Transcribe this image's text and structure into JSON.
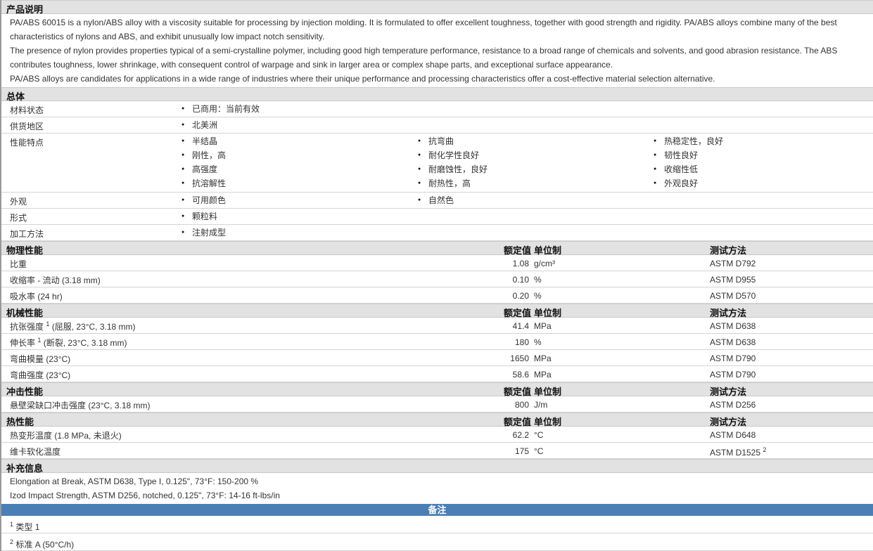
{
  "description": {
    "title": "产品说明",
    "paragraphs": [
      "PA/ABS 60015 is a nylon/ABS alloy with a viscosity suitable for processing by injection molding. It is formulated to offer excellent toughness, together with good strength and rigidity. PA/ABS alloys combine many of the best characteristics of nylons and ABS, and exhibit unusually low impact notch sensitivity.",
      "The presence of nylon provides properties typical of a semi-crystalline polymer, including good high temperature performance, resistance to a broad range of chemicals and solvents, and good abrasion resistance. The ABS contributes toughness, lower shrinkage, with consequent control of warpage and sink in larger area or complex shape parts, and exceptional surface appearance.",
      "PA/ABS alloys are candidates for applications in a wide range of industries where their unique performance and processing characteristics offer a cost-effective material selection alternative."
    ]
  },
  "general": {
    "title": "总体",
    "rows": [
      {
        "label": "材料状态",
        "items": [
          "已商用：当前有效"
        ]
      },
      {
        "label": "供货地区",
        "items": [
          "北美洲"
        ]
      },
      {
        "label": "性能特点",
        "items": [
          "半结晶",
          "刚性，高",
          "高强度",
          "抗溶解性",
          "抗弯曲",
          "耐化学性良好",
          "耐磨蚀性，良好",
          "耐热性，高",
          "热稳定性，良好",
          "韧性良好",
          "收缩性低",
          "外观良好"
        ]
      },
      {
        "label": "外观",
        "items": [
          "可用颜色",
          "自然色"
        ]
      },
      {
        "label": "形式",
        "items": [
          "颗粒料"
        ]
      },
      {
        "label": "加工方法",
        "items": [
          "注射成型"
        ]
      }
    ]
  },
  "headers": {
    "value": "额定值",
    "unit": "单位制",
    "method": "测试方法"
  },
  "sections": [
    {
      "title": "物理性能",
      "rows": [
        {
          "label": "比重",
          "sup": "",
          "cond": "",
          "value": "1.08",
          "unit": "g/cm³",
          "method": "ASTM D792",
          "msup": ""
        },
        {
          "label": "收缩率",
          "sup": "",
          "cond": " - 流动  (3.18 mm)",
          "value": "0.10",
          "unit": "%",
          "method": "ASTM D955",
          "msup": ""
        },
        {
          "label": "吸水率",
          "sup": "",
          "cond": "  (24 hr)",
          "value": "0.20",
          "unit": "%",
          "method": "ASTM D570",
          "msup": ""
        }
      ]
    },
    {
      "title": "机械性能",
      "rows": [
        {
          "label": "抗张强度",
          "sup": "1",
          "cond": " (屈服, 23°C, 3.18 mm)",
          "value": "41.4",
          "unit": "MPa",
          "method": "ASTM D638",
          "msup": ""
        },
        {
          "label": "伸长率",
          "sup": "1",
          "cond": " (断裂, 23°C, 3.18 mm)",
          "value": "180",
          "unit": "%",
          "method": "ASTM D638",
          "msup": ""
        },
        {
          "label": "弯曲模量",
          "sup": "",
          "cond": "  (23°C)",
          "value": "1650",
          "unit": "MPa",
          "method": "ASTM D790",
          "msup": ""
        },
        {
          "label": "弯曲强度",
          "sup": "",
          "cond": "  (23°C)",
          "value": "58.6",
          "unit": "MPa",
          "method": "ASTM D790",
          "msup": ""
        }
      ]
    },
    {
      "title": "冲击性能",
      "rows": [
        {
          "label": "悬壁梁缺口冲击强度",
          "sup": "",
          "cond": "  (23°C, 3.18 mm)",
          "value": "800",
          "unit": "J/m",
          "method": "ASTM D256",
          "msup": ""
        }
      ]
    },
    {
      "title": "热性能",
      "rows": [
        {
          "label": "热变形温度",
          "sup": "",
          "cond": "  (1.8 MPa, 未退火)",
          "value": "62.2",
          "unit": "°C",
          "method": "ASTM D648",
          "msup": ""
        },
        {
          "label": "维卡软化温度",
          "sup": "",
          "cond": "",
          "value": "175",
          "unit": "°C",
          "method": "ASTM D1525",
          "msup": "2"
        }
      ]
    }
  ],
  "supplement": {
    "title": "补充信息",
    "lines": [
      "Elongation at Break, ASTM D638, Type I, 0.125\", 73°F: 150-200 %",
      "Izod Impact Strength, ASTM D256, notched, 0.125\", 73°F: 14-16 ft-lbs/in"
    ]
  },
  "notes": {
    "title": "备注",
    "items": [
      {
        "sup": "1",
        "text": "类型  1"
      },
      {
        "sup": "2",
        "text": "标准  A (50°C/h)"
      }
    ]
  }
}
